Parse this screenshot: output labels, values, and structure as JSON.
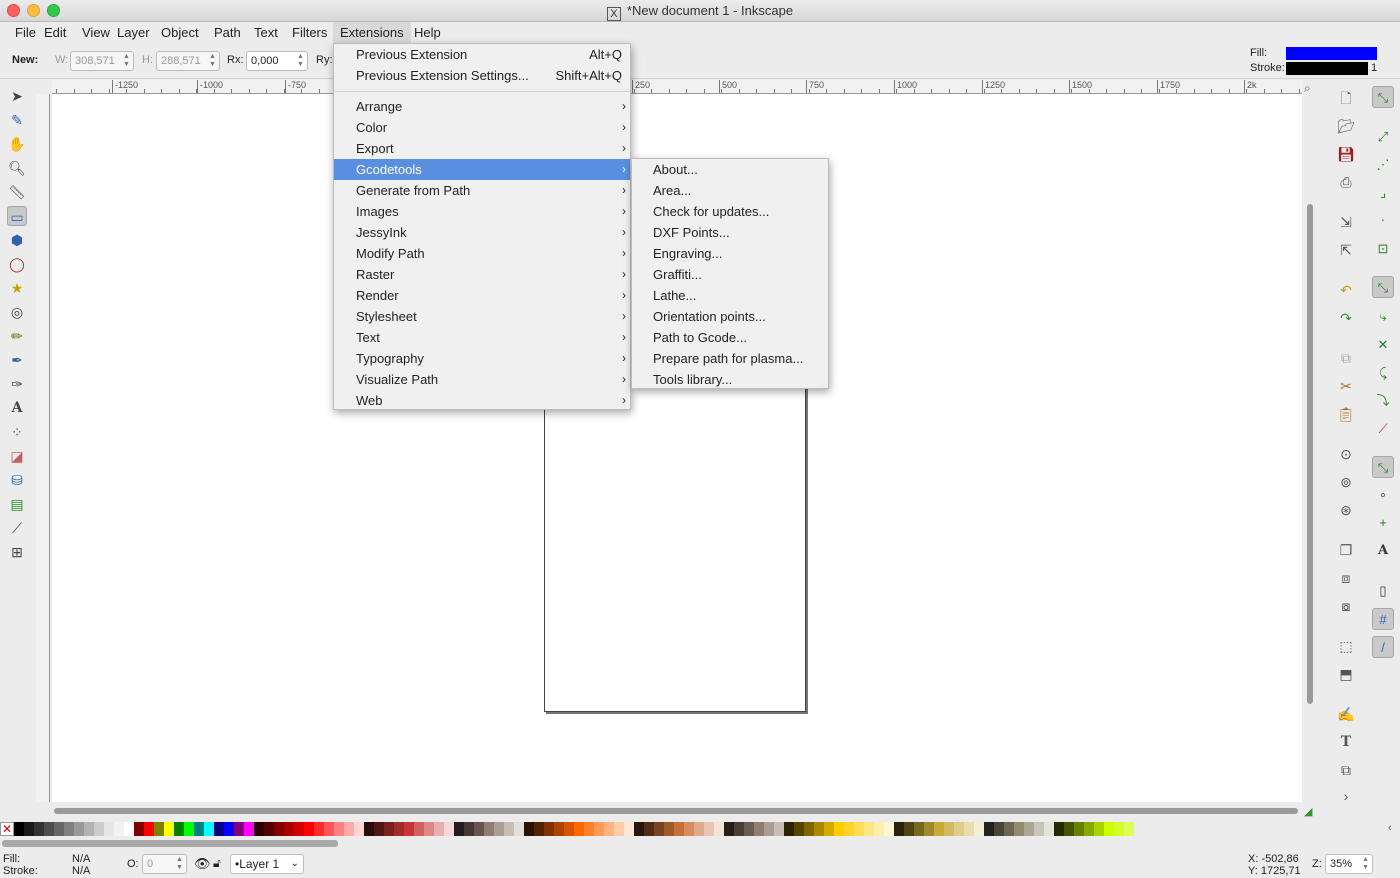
{
  "window": {
    "title": "*New document 1 - Inkscape"
  },
  "menubar": [
    "File",
    "Edit",
    "View",
    "Layer",
    "Object",
    "Path",
    "Text",
    "Filters",
    "Extensions",
    "Help"
  ],
  "active_menu": "Extensions",
  "controls": {
    "new_label": "New:",
    "w_label": "W:",
    "w_value": "308,571",
    "h_label": "H:",
    "h_value": "288,571",
    "rx_label": "Rx:",
    "rx_value": "0,000",
    "ry_label": "Ry:"
  },
  "style_indicator": {
    "fill_label": "Fill:",
    "stroke_label": "Stroke:",
    "fill_color": "#0000ff",
    "stroke_color": "#000000",
    "stroke_width": "1"
  },
  "ruler_labels": [
    "-1250",
    "-1000",
    "-750",
    "250",
    "500",
    "750",
    "1000",
    "1250",
    "1500",
    "1750",
    "2k"
  ],
  "extensions_menu": {
    "top_items": [
      {
        "label": "Previous Extension",
        "shortcut": "Alt+Q"
      },
      {
        "label": "Previous Extension Settings...",
        "shortcut": "Shift+Alt+Q"
      }
    ],
    "items": [
      "Arrange",
      "Color",
      "Export",
      "Gcodetools",
      "Generate from Path",
      "Images",
      "JessyInk",
      "Modify Path",
      "Raster",
      "Render",
      "Stylesheet",
      "Text",
      "Typography",
      "Visualize Path",
      "Web"
    ],
    "highlighted": "Gcodetools",
    "highlight_color": "#5a8fe0"
  },
  "gcodetools_submenu": [
    "About...",
    "Area...",
    "Check for updates...",
    "DXF Points...",
    "Engraving...",
    "Graffiti...",
    "Lathe...",
    "Orientation points...",
    "Path to Gcode...",
    "Prepare path for plasma...",
    "Tools library..."
  ],
  "status": {
    "fill_label": "Fill:",
    "fill_value": "N/A",
    "stroke_label": "Stroke:",
    "stroke_value": "N/A",
    "opacity_label": "O:",
    "opacity_value": "0",
    "layer": "•Layer 1",
    "x_coord": "X: -502,86",
    "y_coord": "Y: 1725,71",
    "zoom_label": "Z:",
    "zoom_value": "35%"
  },
  "palette_colors": [
    "#000000",
    "#1a1a1a",
    "#333333",
    "#4d4d4d",
    "#666666",
    "#808080",
    "#999999",
    "#b3b3b3",
    "#cccccc",
    "#e6e6e6",
    "#f2f2f2",
    "#ffffff",
    "#800000",
    "#ff0000",
    "#808000",
    "#ffff00",
    "#008000",
    "#00ff00",
    "#008080",
    "#00ffff",
    "#000080",
    "#0000ff",
    "#800080",
    "#ff00ff",
    "#2b0000",
    "#550000",
    "#800000",
    "#aa0000",
    "#d40000",
    "#ff0000",
    "#ff2a2a",
    "#ff5555",
    "#ff8080",
    "#ffaaaa",
    "#ffd5d5",
    "#280b0b",
    "#501616",
    "#782121",
    "#a02c2c",
    "#c83737",
    "#d35f5f",
    "#de8787",
    "#e9afaf",
    "#f4d7d7",
    "#241c1c",
    "#483737",
    "#6c5353",
    "#917c6f",
    "#ac9d93",
    "#c8beb7",
    "#e3dedb",
    "#2b1100",
    "#552200",
    "#803300",
    "#aa4400",
    "#d45500",
    "#ff6600",
    "#ff7f2a",
    "#ff9955",
    "#ffb380",
    "#ffccaa",
    "#ffe6d5",
    "#28170b",
    "#502d16",
    "#784421",
    "#a05a2c",
    "#c87137",
    "#d38d5f",
    "#deaa87",
    "#e9c6af",
    "#f4e3d7",
    "#241f1c",
    "#483e37",
    "#6c5d53",
    "#917c6f",
    "#ac9d93",
    "#c8beb7",
    "#2b2200",
    "#554400",
    "#806600",
    "#aa8800",
    "#d4aa00",
    "#ffcc00",
    "#ffd42a",
    "#ffdd55",
    "#ffe680",
    "#ffeeaa",
    "#fff6d5",
    "#28220b",
    "#504416",
    "#786721",
    "#a0892c",
    "#c8ab37",
    "#d3bc5f",
    "#decd87",
    "#e9ddaf",
    "#f4eed7",
    "#24221c",
    "#484537",
    "#6c6753",
    "#918a6f",
    "#aca793",
    "#c8c4b7",
    "#e3e2db",
    "#222b00",
    "#445500",
    "#668000",
    "#88aa00",
    "#aad400",
    "#ccff00",
    "#d4ff2a",
    "#ddff55"
  ]
}
